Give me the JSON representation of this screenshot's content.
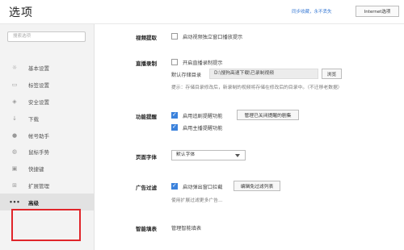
{
  "header": {
    "title": "选项",
    "sync_text": "同步收藏，永不丢失",
    "ie_button": "Internet选项"
  },
  "sidebar": {
    "search_placeholder": "搜索选项",
    "items": [
      {
        "icon": "gear-icon",
        "glyph": "☼",
        "label": "基本设置"
      },
      {
        "icon": "tab-icon",
        "glyph": "▭",
        "label": "标签设置"
      },
      {
        "icon": "shield-icon",
        "glyph": "◈",
        "label": "安全设置"
      },
      {
        "icon": "download-icon",
        "glyph": "↓",
        "label": "下载"
      },
      {
        "icon": "account-icon",
        "glyph": "●",
        "label": "帐号助手"
      },
      {
        "icon": "mouse-icon",
        "glyph": "◍",
        "label": "鼠标手势"
      },
      {
        "icon": "shortcut-icon",
        "glyph": "▣",
        "label": "快捷键"
      },
      {
        "icon": "extension-icon",
        "glyph": "⊞",
        "label": "扩展管理"
      },
      {
        "icon": "more-icon",
        "glyph": "•••",
        "label": "高级"
      }
    ]
  },
  "sections": {
    "video": {
      "label": "视频提取",
      "option1": "启动视频独立窗口播放提示",
      "option1_checked": false
    },
    "live": {
      "label": "直播录制",
      "option1": "开启直播录制提示",
      "option1_checked": false,
      "dir_label": "默认存储目录",
      "dir_value": "D:\\搜狗高速下载\\已录制视频",
      "browse_button": "浏览",
      "note": "提示：存储目录修改后，新录制的视频将存储在修改后的目录中。（不迁移老数据）"
    },
    "feature": {
      "label": "功能提醒",
      "option1": "启用追剧提醒功能",
      "option1_checked": true,
      "manage_button": "管理已关闭提醒的剧集",
      "option2": "启用主播提醒功能",
      "option2_checked": true
    },
    "font": {
      "label": "页面字体",
      "select_value": "默认字体"
    },
    "adblock": {
      "label": "广告过滤",
      "option1": "启动弹出窗口拦截",
      "option1_checked": true,
      "edit_button": "编辑免过滤列表",
      "note": "使用扩展过滤更多广告..."
    },
    "smart": {
      "label": "智能填表",
      "link": "管理智能填表"
    }
  },
  "colors": {
    "accent": "#3b82dc",
    "highlight": "#e0252a"
  }
}
